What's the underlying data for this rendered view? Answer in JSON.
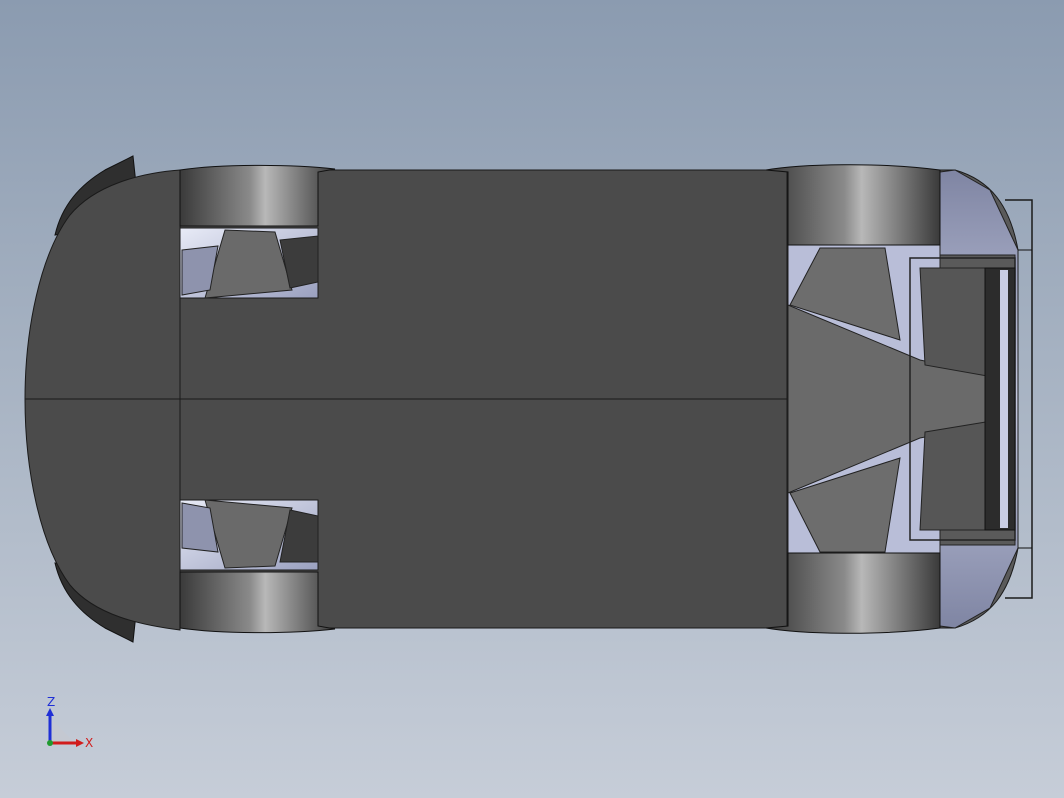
{
  "viewport": {
    "background_top": "#8b9bb0",
    "background_bottom": "#c6cdd8",
    "model_color": "#4a4a4a",
    "wheel_well_color": "#c7cce3"
  },
  "model": {
    "parts": [
      "body-shell",
      "front-wheel-left",
      "front-wheel-right",
      "rear-wheel-left",
      "rear-wheel-right",
      "rear-wing",
      "front-splitter",
      "floor-panel"
    ]
  },
  "triad": {
    "z_label": "Z",
    "x_label": "X",
    "z_color": "#1f2fd6",
    "x_color": "#d11c1c",
    "origin_color": "#1f9b2f"
  }
}
